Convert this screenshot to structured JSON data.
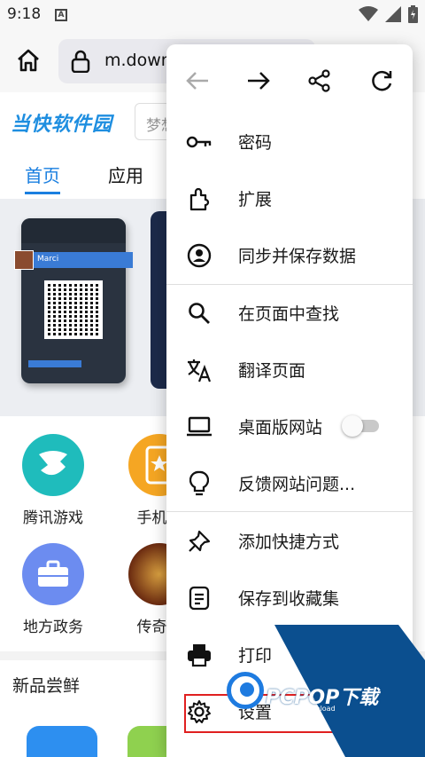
{
  "status_bar": {
    "time": "9:18",
    "notification_letter": "A"
  },
  "toolbar": {
    "url": "m.down"
  },
  "page": {
    "site_logo": "当快软件园",
    "search_placeholder": "梦想",
    "tabs": [
      "首页",
      "应用"
    ],
    "apps_row1": [
      {
        "label": "腾讯游戏",
        "color": "#1fbcbc"
      },
      {
        "label": "手机必",
        "color": "#f5a623"
      }
    ],
    "apps_row2": [
      {
        "label": "地方政务",
        "color": "#6c8cf0"
      },
      {
        "label": "传奇手",
        "color": "#6a2a10"
      }
    ],
    "section_title": "新品尝鲜",
    "banner_user": "Marci"
  },
  "menu": {
    "items": [
      {
        "label": "密码",
        "icon": "key-icon"
      },
      {
        "label": "扩展",
        "icon": "puzzle-icon"
      },
      {
        "label": "同步并保存数据",
        "icon": "account-circle-icon"
      },
      {
        "label": "在页面中查找",
        "icon": "search-icon"
      },
      {
        "label": "翻译页面",
        "icon": "translate-icon"
      },
      {
        "label": "桌面版网站",
        "icon": "laptop-icon",
        "toggle": false
      },
      {
        "label": "反馈网站问题...",
        "icon": "lightbulb-icon"
      },
      {
        "label": "添加快捷方式",
        "icon": "pin-icon"
      },
      {
        "label": "保存到收藏集",
        "icon": "collection-icon"
      },
      {
        "label": "打印",
        "icon": "printer-icon"
      },
      {
        "label": "设置",
        "icon": "gear-icon"
      }
    ]
  },
  "watermark": {
    "title": "PCPOP下载",
    "subtitle": "PCPOP Download"
  },
  "colors": {
    "accent": "#1a7fe0",
    "highlight": "#e02020",
    "watermark_blue": "#0b4f8f"
  }
}
